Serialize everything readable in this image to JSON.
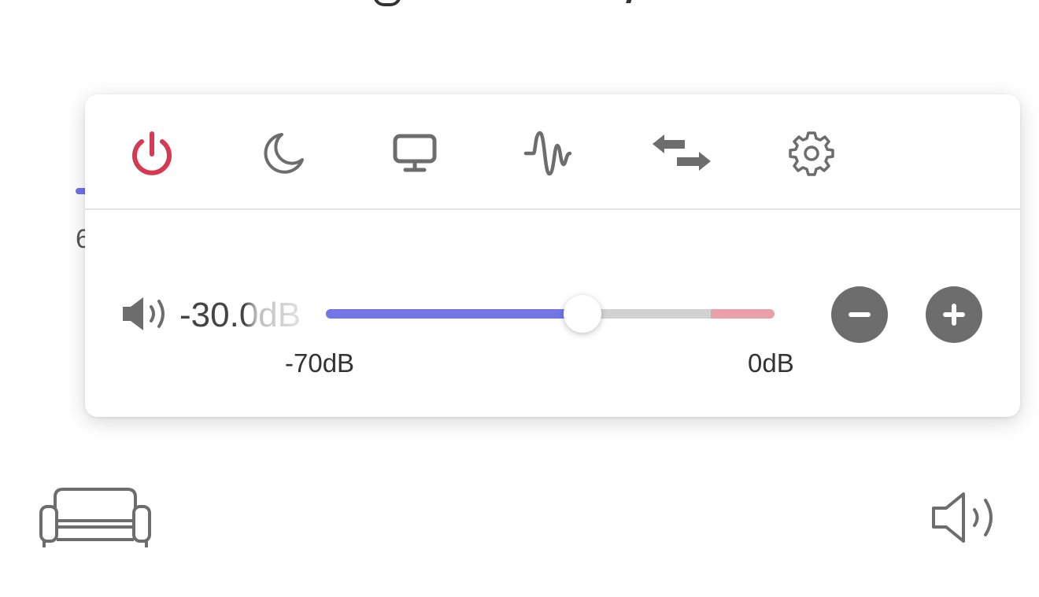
{
  "colors": {
    "accent": "#7476e6",
    "danger_zone": "#e8a0ab",
    "power_active": "#d23b53",
    "icon_gray": "#6d6d6d",
    "track_gray": "#d2d2d2"
  },
  "toolbar": {
    "items": [
      {
        "icon": "power-icon",
        "active": true
      },
      {
        "icon": "moon-icon",
        "active": false
      },
      {
        "icon": "monitor-icon",
        "active": false
      },
      {
        "icon": "waveform-icon",
        "active": false
      },
      {
        "icon": "swap-arrows-icon",
        "active": false
      },
      {
        "icon": "gear-icon",
        "active": false
      }
    ]
  },
  "volume": {
    "readout": "-30.0dB",
    "value_db": -30,
    "min_db": -70,
    "max_db": 0,
    "danger_from_db": -10,
    "min_label": "-70dB",
    "max_label": "0dB"
  },
  "buttons": {
    "decrease_icon": "minus-icon",
    "increase_icon": "plus-icon"
  },
  "footer": {
    "left_icon": "sofa-icon",
    "right_icon": "volume-outline-icon"
  }
}
